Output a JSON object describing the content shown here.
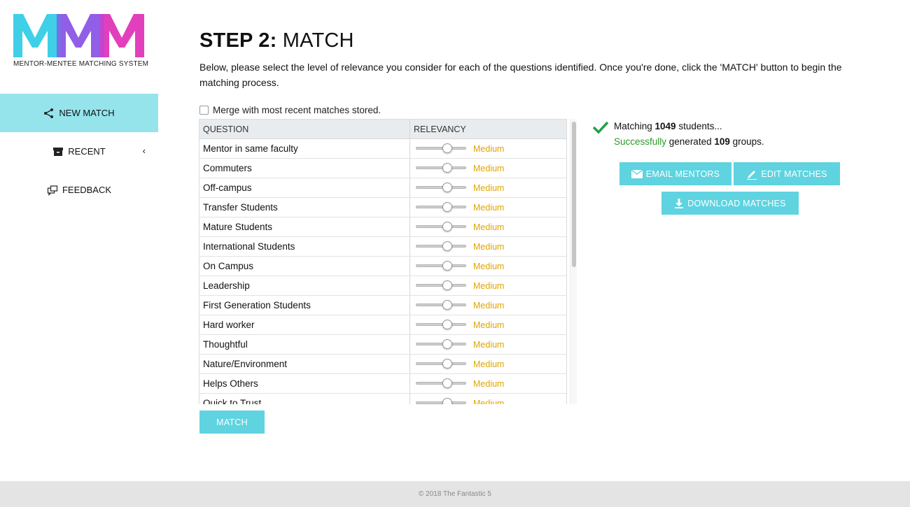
{
  "logo": {
    "mark": "MMM",
    "subtitle": "MENTOR-MENTEE MATCHING SYSTEM",
    "colors": [
      "#3fd0e8",
      "#8a55e6",
      "#d63ac8",
      "#ff4ea3"
    ]
  },
  "sidebar": {
    "items": [
      {
        "label": "NEW MATCH",
        "icon": "share-nodes-icon",
        "active": true
      },
      {
        "label": "RECENT",
        "icon": "archive-icon",
        "active": false,
        "chevron": "‹"
      },
      {
        "label": "FEEDBACK",
        "icon": "feedback-icon",
        "active": false
      }
    ]
  },
  "main": {
    "title_bold": "STEP 2:",
    "title_rest": " MATCH",
    "description": "Below, please select the level of relevance you consider for each of the questions identified. Once you're done, click the 'MATCH' button to begin the matching process.",
    "merge_label": "Merge with most recent matches stored.",
    "merge_checked": false,
    "table": {
      "headers": [
        "QUESTION",
        "RELEVANCY"
      ],
      "rows": [
        {
          "question": "Mentor in same faculty",
          "relevancy": "Medium",
          "level": 0.5
        },
        {
          "question": "Commuters",
          "relevancy": "Medium",
          "level": 0.5
        },
        {
          "question": "Off-campus",
          "relevancy": "Medium",
          "level": 0.5
        },
        {
          "question": "Transfer Students",
          "relevancy": "Medium",
          "level": 0.5
        },
        {
          "question": "Mature Students",
          "relevancy": "Medium",
          "level": 0.5
        },
        {
          "question": "International Students",
          "relevancy": "Medium",
          "level": 0.5
        },
        {
          "question": "On Campus",
          "relevancy": "Medium",
          "level": 0.5
        },
        {
          "question": "Leadership",
          "relevancy": "Medium",
          "level": 0.5
        },
        {
          "question": "First Generation Students",
          "relevancy": "Medium",
          "level": 0.5
        },
        {
          "question": "Hard worker",
          "relevancy": "Medium",
          "level": 0.5
        },
        {
          "question": "Thoughtful",
          "relevancy": "Medium",
          "level": 0.5
        },
        {
          "question": "Nature/Environment",
          "relevancy": "Medium",
          "level": 0.5
        },
        {
          "question": "Helps Others",
          "relevancy": "Medium",
          "level": 0.5
        },
        {
          "question": "Quick to Trust",
          "relevancy": "Medium",
          "level": 0.5
        }
      ]
    },
    "match_button": "MATCH"
  },
  "status": {
    "line1_prefix": "Matching ",
    "students_count": "1049",
    "line1_suffix": " students...",
    "success_word": "Successfully",
    "line2_mid": " generated ",
    "groups_count": "109",
    "line2_suffix": " groups.",
    "buttons": {
      "email": "EMAIL MENTORS",
      "edit": "EDIT MATCHES",
      "download": "DOWNLOAD MATCHES"
    }
  },
  "footer": {
    "text": "© 2018 The Fantastic 5"
  },
  "colors": {
    "accent": "#5fd3e0",
    "active_nav": "#95e4ec",
    "relevancy_text": "#e0a400",
    "success": "#2a9a2a",
    "check": "#22a04a"
  }
}
